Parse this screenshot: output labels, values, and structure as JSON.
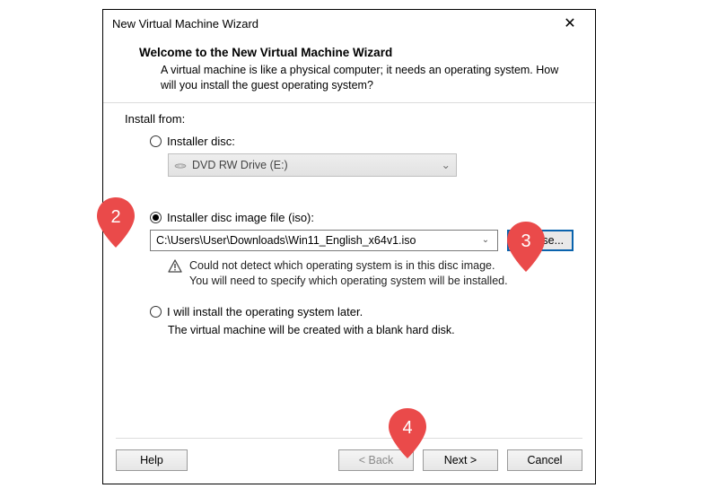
{
  "window": {
    "title": "New Virtual Machine Wizard"
  },
  "header": {
    "heading": "Welcome to the New Virtual Machine Wizard",
    "subtext": "A virtual machine is like a physical computer; it needs an operating system. How will you install the guest operating system?"
  },
  "install": {
    "group_label": "Install from:",
    "disc": {
      "label": "Installer disc:",
      "drive_text": "DVD RW Drive (E:)",
      "selected": false
    },
    "iso": {
      "label": "Installer disc image file (iso):",
      "path": "C:\\Users\\User\\Downloads\\Win11_English_x64v1.iso",
      "browse_label": "Browse...",
      "selected": true,
      "warning_line1": "Could not detect which operating system is in this disc image.",
      "warning_line2": "You will need to specify which operating system will be installed."
    },
    "later": {
      "label": "I will install the operating system later.",
      "note": "The virtual machine will be created with a blank hard disk.",
      "selected": false
    }
  },
  "buttons": {
    "help": "Help",
    "back": "< Back",
    "next": "Next >",
    "cancel": "Cancel"
  },
  "annotations": {
    "m2": "2",
    "m3": "3",
    "m4": "4"
  }
}
